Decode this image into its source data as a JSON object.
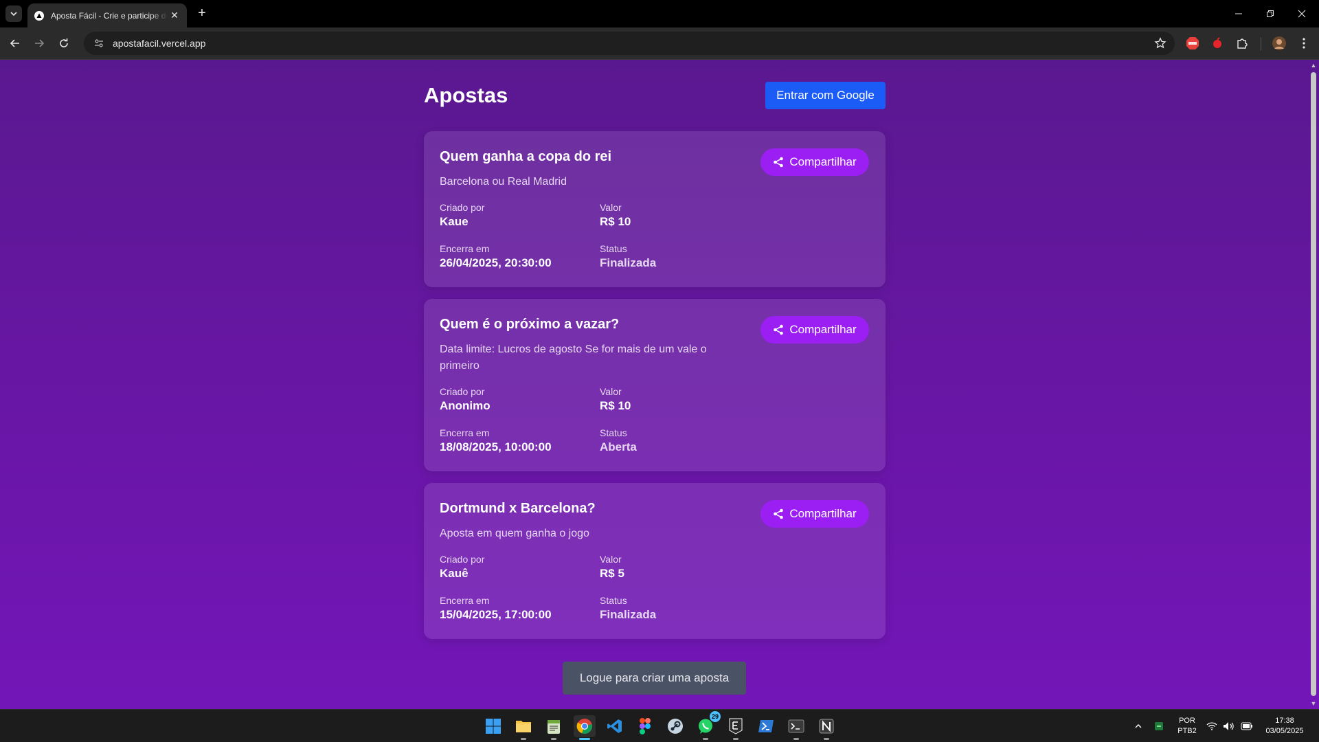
{
  "browser": {
    "tab_title": "Aposta Fácil - Crie e participe de apostas",
    "url": "apostafacil.vercel.app",
    "tab_close": "✕",
    "new_tab": "+"
  },
  "page": {
    "title": "Apostas",
    "login_button": "Entrar com Google",
    "create_button": "Logue para criar uma aposta",
    "share_label": "Compartilhar",
    "labels": {
      "created_by": "Criado por",
      "value": "Valor",
      "ends_at": "Encerra em",
      "status": "Status"
    },
    "bets": [
      {
        "title": "Quem ganha a copa do rei",
        "description": "Barcelona ou Real Madrid",
        "created_by": "Kaue",
        "value": "R$ 10",
        "ends_at": "26/04/2025, 20:30:00",
        "status": "Finalizada"
      },
      {
        "title": "Quem é o próximo a vazar?",
        "description": "Data limite: Lucros de agosto Se for mais de um vale o primeiro",
        "created_by": "Anonimo",
        "value": "R$ 10",
        "ends_at": "18/08/2025, 10:00:00",
        "status": "Aberta"
      },
      {
        "title": "Dortmund x Barcelona?",
        "description": "Aposta em quem ganha o jogo",
        "created_by": "Kauê",
        "value": "R$ 5",
        "ends_at": "15/04/2025, 17:00:00",
        "status": "Finalizada"
      }
    ]
  },
  "taskbar": {
    "whatsapp_badge": "29",
    "language": "POR",
    "layout": "PTB2",
    "time": "17:38",
    "date": "03/05/2025"
  },
  "colors": {
    "accent": "#9b1ef2",
    "google_button": "#1a5cf5",
    "background": "#6a16a8"
  }
}
